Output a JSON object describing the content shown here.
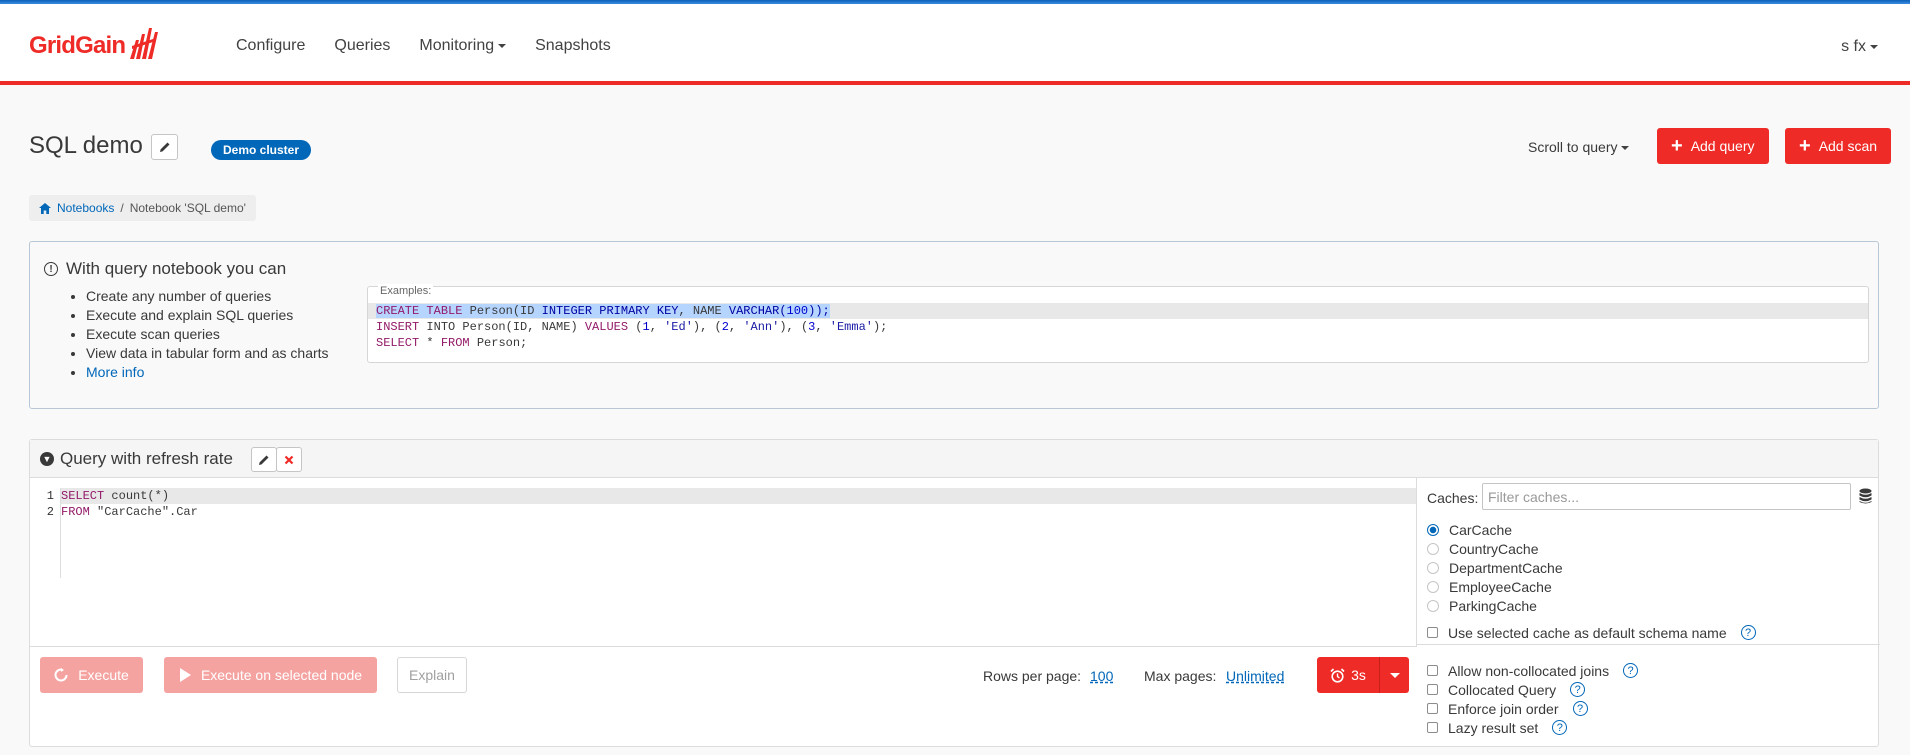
{
  "header": {
    "brand": "GridGain",
    "nav": [
      {
        "label": "Configure"
      },
      {
        "label": "Queries"
      },
      {
        "label": "Monitoring"
      },
      {
        "label": "Snapshots"
      }
    ],
    "user": "s fx"
  },
  "page": {
    "title": "SQL demo",
    "cluster_badge": "Demo cluster",
    "scroll_to_query": "Scroll to query",
    "add_query": "Add query",
    "add_scan": "Add scan"
  },
  "breadcrumb": {
    "root": "Notebooks",
    "separator": "/",
    "current": "Notebook 'SQL demo'"
  },
  "info": {
    "title": "With query notebook you can",
    "items": [
      "Create any number of queries",
      "Execute and explain SQL queries",
      "Execute scan queries",
      "View data in tabular form and as charts"
    ],
    "more_info": "More info",
    "examples_label": "Examples:",
    "examples": {
      "l1": {
        "a": "CREATE",
        "b": "TABLE",
        "c": " Person(ID ",
        "d": "INTEGER PRIMARY KEY",
        "e": ", NAME ",
        "f": "VARCHAR",
        "g": "(",
        "h": "100",
        "i": "));"
      },
      "l2": {
        "a": "INSERT",
        "b": " INTO Person(ID, NAME) ",
        "c": "VALUES",
        "d": " (",
        "e": "1",
        "f": ", ",
        "g": "'Ed'",
        "h": "), (",
        "i": "2",
        "j": ", ",
        "k": "'Ann'",
        "l": "), (",
        "m": "3",
        "n": ", ",
        "o": "'Emma'",
        "p": ");"
      },
      "l3": {
        "a": "SELECT",
        "b": " * ",
        "c": "FROM",
        "d": " Person;"
      }
    }
  },
  "query": {
    "title": "Query with refresh rate",
    "line_numbers": [
      "1",
      "2"
    ],
    "code": {
      "l1": {
        "a": "SELECT",
        "b": " count(*)"
      },
      "l2": {
        "a": "FROM",
        "b": " \"CarCache\".Car"
      }
    },
    "caches_label": "Caches:",
    "caches_placeholder": "Filter caches...",
    "caches": [
      "CarCache",
      "CountryCache",
      "DepartmentCache",
      "EmployeeCache",
      "ParkingCache"
    ],
    "selected_cache": "CarCache",
    "default_schema": "Use selected cache as default schema name",
    "options": [
      "Allow non-collocated joins",
      "Collocated Query",
      "Enforce join order",
      "Lazy result set"
    ],
    "execute": "Execute",
    "execute_selected": "Execute on selected node",
    "explain": "Explain",
    "rows_per_page_label": "Rows per page:",
    "rows_per_page": "100",
    "max_pages_label": "Max pages:",
    "max_pages": "Unlimited",
    "refresh": "3s"
  },
  "colors": {
    "brand_red": "#ee2b27",
    "link_blue": "#0067b9"
  }
}
